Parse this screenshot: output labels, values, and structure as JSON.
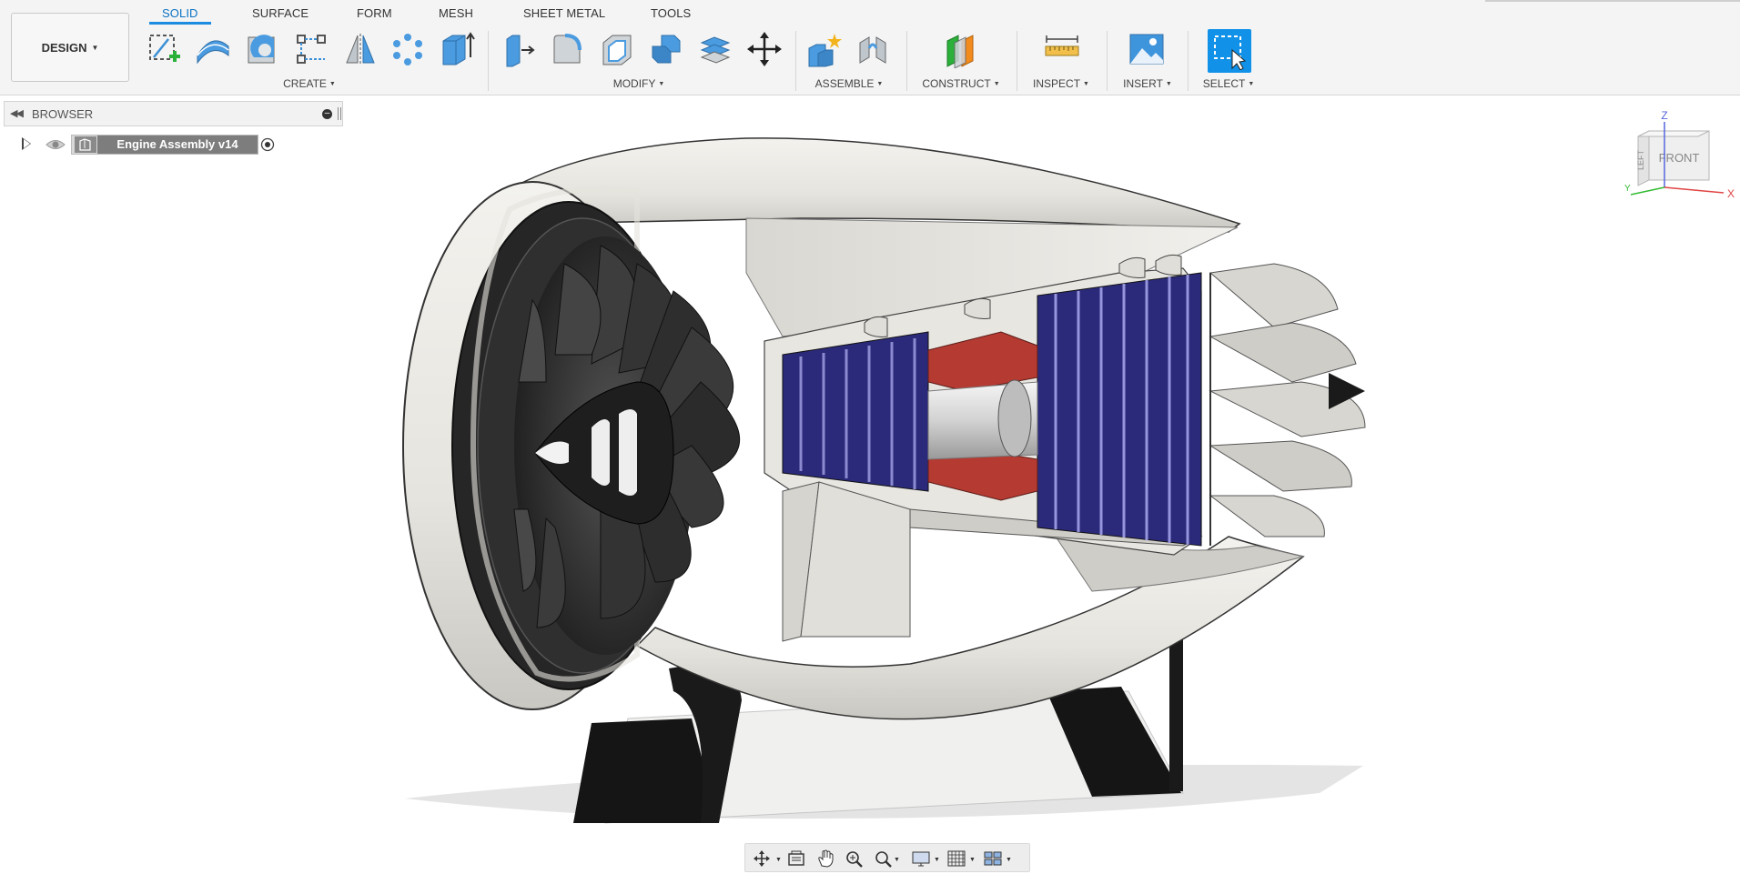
{
  "app": {
    "workspace_button": "DESIGN"
  },
  "tabs": [
    {
      "label": "SOLID",
      "active": true
    },
    {
      "label": "SURFACE"
    },
    {
      "label": "FORM"
    },
    {
      "label": "MESH"
    },
    {
      "label": "SHEET METAL"
    },
    {
      "label": "TOOLS"
    }
  ],
  "groups": {
    "create": "CREATE",
    "modify": "MODIFY",
    "assemble": "ASSEMBLE",
    "construct": "CONSTRUCT",
    "inspect": "INSPECT",
    "insert": "INSERT",
    "select": "SELECT"
  },
  "tools": {
    "create": [
      "create-sketch-icon",
      "sweep-icon",
      "revolve-icon",
      "project-icon",
      "mirror-icon",
      "pattern-icon",
      "extrude-icon"
    ],
    "modify": [
      "press-pull-icon",
      "fillet-icon",
      "shell-icon",
      "combine-icon",
      "offset-face-icon",
      "move-icon"
    ],
    "assemble": [
      "new-component-icon",
      "joint-icon"
    ],
    "construct": [
      "offset-plane-icon"
    ],
    "inspect": [
      "measure-icon"
    ],
    "insert": [
      "insert-image-icon"
    ],
    "select": [
      "select-box-icon"
    ]
  },
  "browser": {
    "title": "BROWSER",
    "root_item": "Engine Assembly v14"
  },
  "viewcube": {
    "face_front": "FRONT",
    "face_left": "LEFT",
    "axis_z": "Z",
    "axis_x": "X",
    "axis_y": "Y"
  },
  "colors": {
    "accent": "#0b73c4",
    "select_tool": "#1192e8",
    "compressor_blades": "#2b2a7a",
    "combustor": "#b53a32",
    "nacelle": "#e9e7e2",
    "fan": "#2a2a2a"
  },
  "navbar": [
    "orbit-icon",
    "look-at-icon",
    "pan-icon",
    "zoom-icon",
    "fit-icon",
    "display-settings-icon",
    "grid-icon",
    "viewports-icon"
  ]
}
